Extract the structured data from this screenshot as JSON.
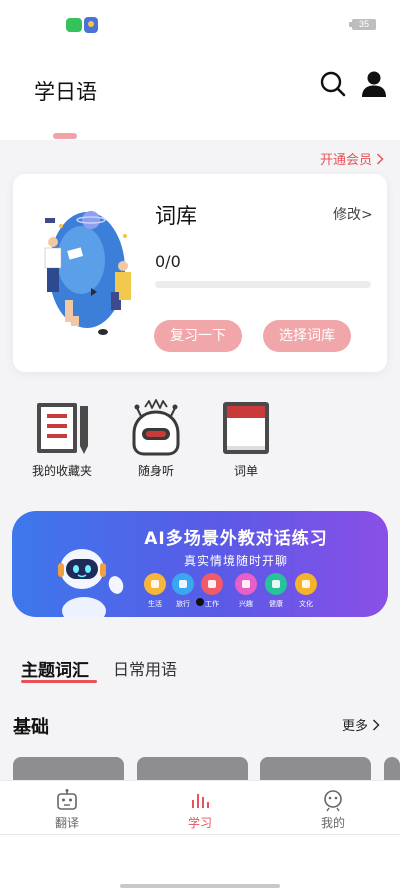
{
  "status_bar": {
    "battery": "35"
  },
  "header": {
    "title": "学日语",
    "search_icon": "search-icon",
    "profile_icon": "user-icon"
  },
  "vip": {
    "label": "开通会员"
  },
  "vocab_card": {
    "title": "词库",
    "modify": "修改>",
    "progress_text": "0/0",
    "progress_fraction": 0,
    "review_button": "复习一下",
    "select_button": "选择词库"
  },
  "tools": [
    {
      "label": "我的收藏夹",
      "icon": "notebook-pen-icon"
    },
    {
      "label": "随身听",
      "icon": "robot-listen-icon"
    },
    {
      "label": "词单",
      "icon": "book-icon"
    }
  ],
  "banner": {
    "title": "AI多场景外教对话练习",
    "subtitle": "真实情境随时开聊",
    "scenes": [
      {
        "label": "生活",
        "color": "#f6b63a"
      },
      {
        "label": "旅行",
        "color": "#39a8f0"
      },
      {
        "label": "工作",
        "color": "#f25a6a"
      },
      {
        "label": "兴趣",
        "color": "#e85fc7"
      },
      {
        "label": "健康",
        "color": "#27c39a"
      },
      {
        "label": "文化",
        "color": "#f5b32a"
      }
    ]
  },
  "topic_tabs": {
    "active": "主题词汇",
    "inactive": "日常用语"
  },
  "section": {
    "title": "基础",
    "more": "更多"
  },
  "bottom_nav": [
    {
      "label": "翻译",
      "icon": "robot-icon"
    },
    {
      "label": "学习",
      "icon": "bars-icon"
    },
    {
      "label": "我的",
      "icon": "face-icon"
    }
  ],
  "colors": {
    "accent": "#e8525a",
    "button_pink": "#f1a7aa",
    "banner_start": "#3d78ec",
    "banner_end": "#8a4fe6"
  }
}
